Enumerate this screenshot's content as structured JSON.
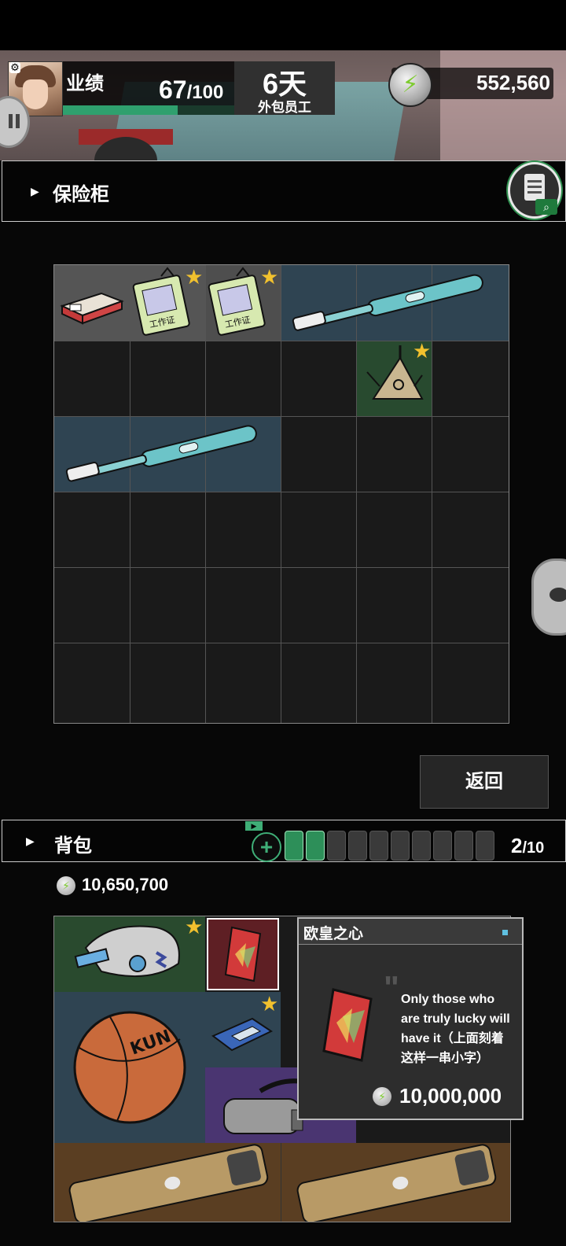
{
  "header": {
    "performance_label": "业绩",
    "performance_value": "67",
    "performance_max": "/100",
    "performance_progress": 0.67,
    "days": "6天",
    "role": "外包员工",
    "coins": "552,560"
  },
  "safe": {
    "title": "保险柜",
    "back_label": "返回"
  },
  "backpack": {
    "title": "背包",
    "charges_used": 2,
    "charges_total": 10,
    "capacity_used": "2",
    "capacity_max": "/10",
    "money": "10,650,700"
  },
  "tooltip": {
    "name": "欧皇之心",
    "description": "Only those who are truly lucky will have it（上面刻着这样一串小字）",
    "price": "10,000,000"
  },
  "colors": {
    "accent_green": "#3fae77",
    "star_gold": "#f2c12e",
    "coin_bolt": "#7ecb30"
  },
  "icons": [
    "settings-gear-icon",
    "pause-icon",
    "clipboard-search-icon",
    "chat-icon",
    "lightning-coin-icon",
    "plus-icon",
    "battery-icon",
    "star-icon"
  ]
}
